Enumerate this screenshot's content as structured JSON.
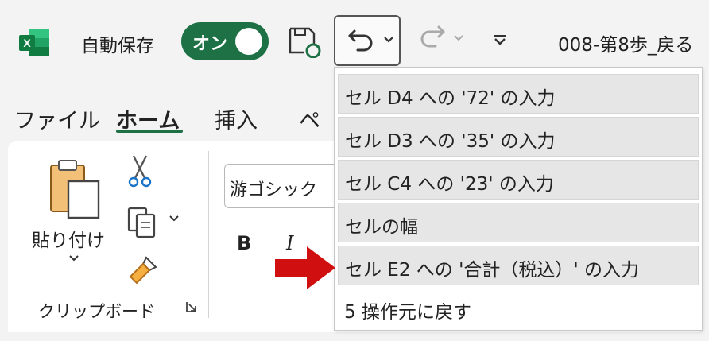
{
  "app": {
    "autosave_label": "自動保存",
    "toggle_label": "オン",
    "filename": "008-第8歩_戻る",
    "accent_color": "#1e7145"
  },
  "tabs": [
    {
      "label": "ファイル"
    },
    {
      "label": "ホーム"
    },
    {
      "label": "挿入"
    },
    {
      "label": "ペ"
    }
  ],
  "ribbon": {
    "paste_label": "貼り付け",
    "clipboard_group_label": "クリップボード",
    "font_name": "游ゴシック",
    "bold_label": "B",
    "italic_label": "I"
  },
  "undo_list": {
    "items": [
      {
        "label": "セル D4 への '72' の入力"
      },
      {
        "label": "セル D3 への '35' の入力"
      },
      {
        "label": "セル C4 への '23' の入力"
      },
      {
        "label": "セルの幅"
      },
      {
        "label": "セル E2 への '合計（税込）' の入力"
      }
    ],
    "footer": "5 操作元に戻す",
    "highlight_color": "#e6e6e6"
  },
  "annotation": {
    "arrow_color": "#d01010"
  }
}
